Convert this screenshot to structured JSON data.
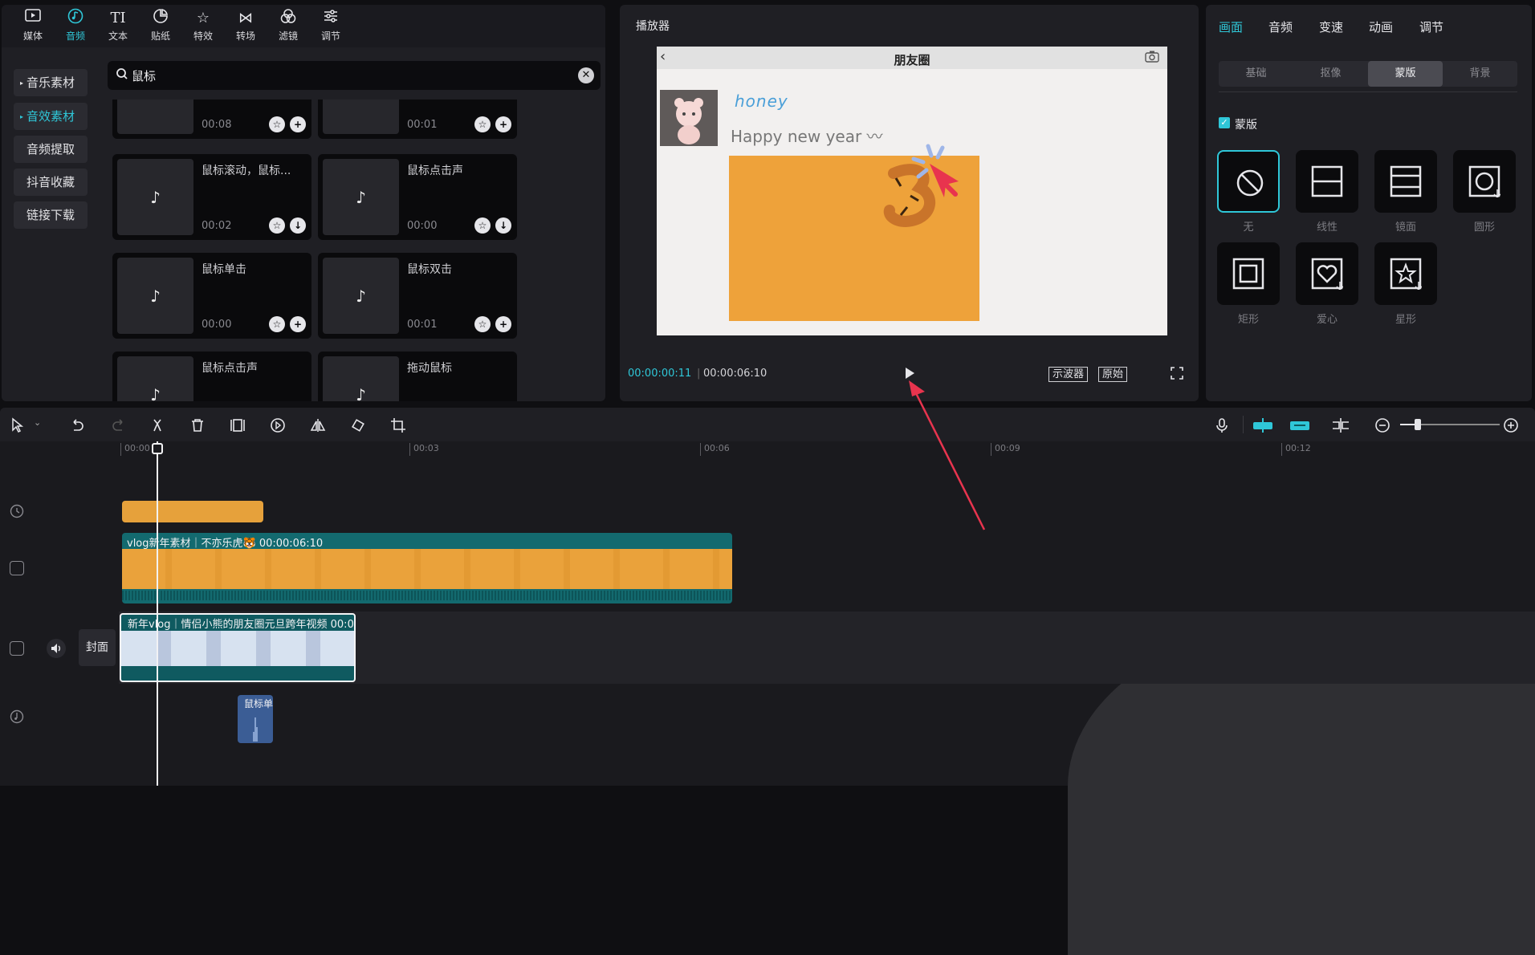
{
  "media_tabs": [
    {
      "label": "媒体",
      "icon": "media-icon"
    },
    {
      "label": "音频",
      "icon": "audio-icon"
    },
    {
      "label": "文本",
      "icon": "text-icon"
    },
    {
      "label": "贴纸",
      "icon": "sticker-icon"
    },
    {
      "label": "特效",
      "icon": "effects-icon"
    },
    {
      "label": "转场",
      "icon": "transition-icon"
    },
    {
      "label": "滤镜",
      "icon": "filter-icon"
    },
    {
      "label": "调节",
      "icon": "adjust-icon"
    }
  ],
  "media_tabs_active": "音频",
  "side_categories": [
    "音乐素材",
    "音效素材",
    "音频提取",
    "抖音收藏",
    "链接下载"
  ],
  "side_categories_active": "音效素材",
  "search": {
    "value": "鼠标"
  },
  "results": [
    {
      "title": "",
      "duration": "00:08"
    },
    {
      "title": "",
      "duration": "00:01"
    },
    {
      "title": "鼠标滚动，鼠标...",
      "duration": "00:02"
    },
    {
      "title": "鼠标点击声",
      "duration": "00:00"
    },
    {
      "title": "鼠标单击",
      "duration": "00:00"
    },
    {
      "title": "鼠标双击",
      "duration": "00:01"
    },
    {
      "title": "鼠标点击声",
      "duration": ""
    },
    {
      "title": "拖动鼠标",
      "duration": ""
    }
  ],
  "player": {
    "title": "播放器",
    "current_time": "00:00:00:11",
    "total_time": "00:00:06:10",
    "oscilloscope_label": "示波器",
    "original_label": "原始",
    "preview": {
      "phone_title": "朋友圈",
      "post_name": "honey",
      "post_text": "Happy new year 〰",
      "image_color": "#eea23a"
    }
  },
  "props": {
    "tabs": [
      "画面",
      "音频",
      "变速",
      "动画",
      "调节"
    ],
    "active_tab": "画面",
    "subtabs": [
      "基础",
      "抠像",
      "蒙版",
      "背景"
    ],
    "active_subtab": "蒙版",
    "mask_toggle_label": "蒙版",
    "mask_enabled": true,
    "masks": [
      "无",
      "线性",
      "镜面",
      "圆形",
      "矩形",
      "爱心",
      "星形"
    ],
    "selected_mask": "无"
  },
  "timeline": {
    "ruler": [
      "00:00",
      "00:03",
      "00:06",
      "00:09",
      "00:12"
    ],
    "vlog_clip_label": "vlog新年素材｜不亦乐虎🐯   00:00:06:10",
    "main_clip_label": "新年vlog｜情侣小熊的朋友圈元旦跨年视频    00:0",
    "audio_clip_label": "鼠标单",
    "cover_label": "封面"
  },
  "colors": {
    "accent": "#2fc7d8",
    "annotation": "#e8344e"
  }
}
